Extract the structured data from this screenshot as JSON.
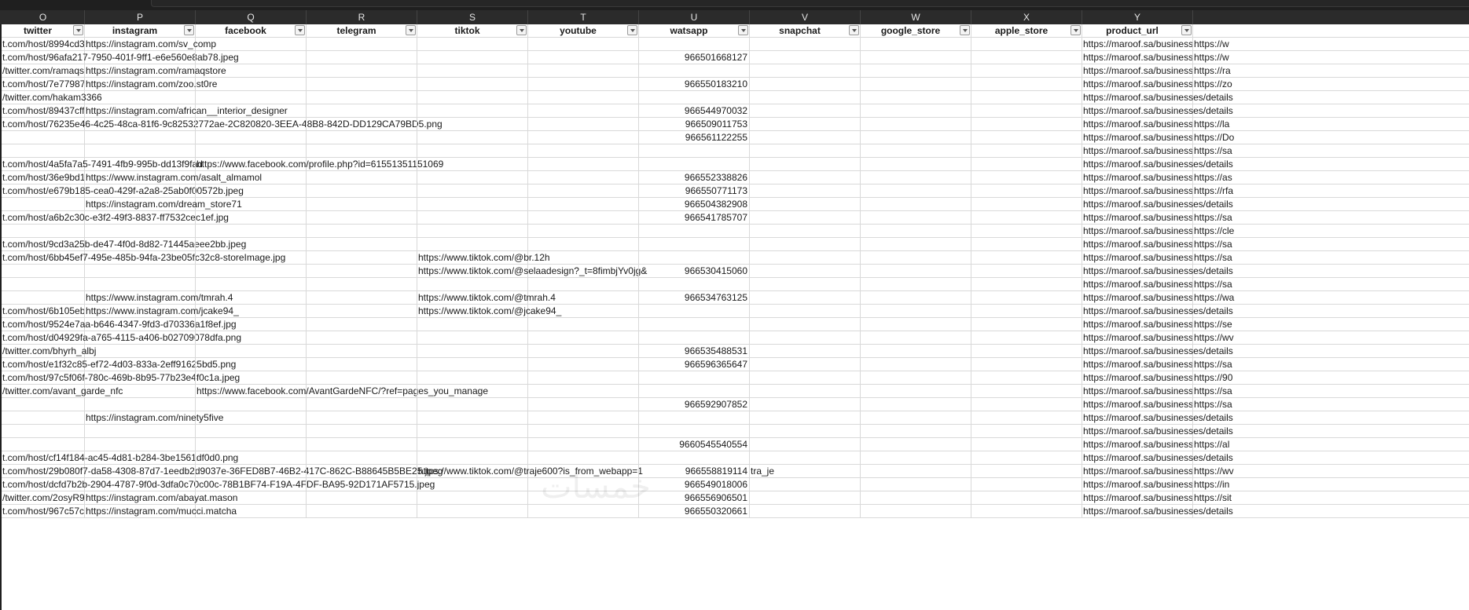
{
  "column_letters": [
    "O",
    "P",
    "Q",
    "R",
    "S",
    "T",
    "U",
    "V",
    "W",
    "X",
    "Y"
  ],
  "headers": [
    "twitter",
    "instagram",
    "facebook",
    "telegram",
    "tiktok",
    "youtube",
    "watsapp",
    "snapchat",
    "google_store",
    "apple_store",
    "product_url"
  ],
  "rows": [
    {
      "O": "t.com/host/8994cd3",
      "P": "https://instagram.com/sv_comp",
      "Q": "",
      "S": "",
      "U": "",
      "V": "",
      "Y": "https://maroof.sa/business",
      "Z": "https://w"
    },
    {
      "O": "t.com/host/96afa217-7950-401f-9ff1-e6e560e8ab78.jpeg",
      "P": "",
      "Q": "",
      "S": "",
      "U": "966501668127",
      "V": "",
      "Y": "https://maroof.sa/business",
      "Z": "https://w"
    },
    {
      "O": "/twitter.com/ramaqs",
      "P": "https://instagram.com/ramaqstore",
      "Q": "",
      "S": "",
      "U": "",
      "V": "",
      "Y": "https://maroof.sa/business",
      "Z": "https://ra"
    },
    {
      "O": "t.com/host/7e77987",
      "P": "https://instagram.com/zoo.st0re",
      "Q": "",
      "S": "",
      "U": "966550183210",
      "V": "",
      "Y": "https://maroof.sa/business",
      "Z": "https://zo"
    },
    {
      "O": "/twitter.com/hakam3366",
      "P": "",
      "Q": "",
      "S": "",
      "U": "",
      "V": "",
      "Y": "https://maroof.sa/businesses/details",
      "Z": ""
    },
    {
      "O": "t.com/host/89437cff",
      "P": "https://instagram.com/african__interior_designer",
      "Q": "",
      "S": "",
      "U": "966544970032",
      "V": "",
      "Y": "https://maroof.sa/businesses/details",
      "Z": ""
    },
    {
      "O": "t.com/host/76235e46-4c25-48ca-81f6-9c82532772ae-2C820820-3EEA-48B8-842D-DD129CA79BD5.png",
      "P": "",
      "Q": "",
      "S": "",
      "U": "966509011753",
      "V": "",
      "Y": "https://maroof.sa/business",
      "Z": "https://la"
    },
    {
      "O": "",
      "P": "",
      "Q": "",
      "S": "",
      "U": "966561122255",
      "V": "",
      "Y": "https://maroof.sa/business",
      "Z": "https://Do"
    },
    {
      "O": "",
      "P": "",
      "Q": "",
      "S": "",
      "U": "",
      "V": "",
      "Y": "https://maroof.sa/business",
      "Z": "https://sa"
    },
    {
      "O": "t.com/host/4a5fa7a5-7491-4fb9-995b-dd13f9fad",
      "P": "",
      "Q": "https://www.facebook.com/profile.php?id=61551351151069",
      "S": "",
      "U": "",
      "V": "",
      "Y": "https://maroof.sa/businesses/details",
      "Z": ""
    },
    {
      "O": "t.com/host/36e9bd1",
      "P": "https://www.instagram.com/asalt_almamol",
      "Q": "",
      "S": "",
      "U": "966552338826",
      "V": "",
      "Y": "https://maroof.sa/business",
      "Z": "https://as"
    },
    {
      "O": "t.com/host/e679b185-cea0-429f-a2a8-25ab0f00572b.jpeg",
      "P": "",
      "Q": "",
      "S": "",
      "U": "966550771173",
      "V": "",
      "Y": "https://maroof.sa/business",
      "Z": "https://rfa"
    },
    {
      "O": "",
      "P": "https://instagram.com/dream_store71",
      "Q": "",
      "S": "",
      "U": "966504382908",
      "V": "",
      "Y": "https://maroof.sa/businesses/details",
      "Z": ""
    },
    {
      "O": "t.com/host/a6b2c30c-e3f2-49f3-8837-ff7532cec1ef.jpg",
      "P": "",
      "Q": "",
      "S": "",
      "U": "966541785707",
      "V": "",
      "Y": "https://maroof.sa/business",
      "Z": "https://sa"
    },
    {
      "O": "",
      "P": "",
      "Q": "",
      "S": "",
      "U": "",
      "V": "",
      "Y": "https://maroof.sa/business",
      "Z": "https://cle"
    },
    {
      "O": "t.com/host/9cd3a25b-de47-4f0d-8d82-71445aeee2bb.jpeg",
      "P": "",
      "Q": "",
      "S": "",
      "U": "",
      "V": "",
      "Y": "https://maroof.sa/business",
      "Z": "https://sa"
    },
    {
      "O": "t.com/host/6bb45ef7-495e-485b-94fa-23be05fc32c8-storeImage.jpg",
      "P": "",
      "Q": "",
      "S": "https://www.tiktok.com/@br.12h",
      "U": "",
      "V": "",
      "Y": "https://maroof.sa/business",
      "Z": "https://sa"
    },
    {
      "O": "",
      "P": "",
      "Q": "",
      "S": "https://www.tiktok.com/@selaadesign?_t=8fimbjYv0jg&",
      "U": "966530415060",
      "V": "",
      "Y": "https://maroof.sa/businesses/details",
      "Z": ""
    },
    {
      "O": "",
      "P": "",
      "Q": "",
      "S": "",
      "U": "",
      "V": "",
      "Y": "https://maroof.sa/business",
      "Z": "https://sa"
    },
    {
      "O": "",
      "P": "https://www.instagram.com/tmrah.4",
      "Q": "",
      "S": "https://www.tiktok.com/@tmrah.4",
      "U": "966534763125",
      "V": "",
      "Y": "https://maroof.sa/business",
      "Z": "https://wa"
    },
    {
      "O": "t.com/host/6b105eb",
      "P": "https://www.instagram.com/jcake94_",
      "Q": "",
      "S": "https://www.tiktok.com/@jcake94_",
      "U": "",
      "V": "",
      "Y": "https://maroof.sa/businesses/details",
      "Z": ""
    },
    {
      "O": "t.com/host/9524e7aa-b646-4347-9fd3-d70336a1f8ef.jpg",
      "P": "",
      "Q": "",
      "S": "",
      "U": "",
      "V": "",
      "Y": "https://maroof.sa/business",
      "Z": "https://se"
    },
    {
      "O": "t.com/host/d04929fa-a765-4115-a406-b02709078dfa.png",
      "P": "",
      "Q": "",
      "S": "",
      "U": "",
      "V": "",
      "Y": "https://maroof.sa/business",
      "Z": "https://wv"
    },
    {
      "O": "/twitter.com/bhyrh_albj",
      "P": "",
      "Q": "",
      "S": "",
      "U": "966535488531",
      "V": "",
      "Y": "https://maroof.sa/businesses/details",
      "Z": ""
    },
    {
      "O": "t.com/host/e1f32c85-ef72-4d03-833a-2eff91625bd5.png",
      "P": "",
      "Q": "",
      "S": "",
      "U": "966596365647",
      "V": "",
      "Y": "https://maroof.sa/business",
      "Z": "https://sa"
    },
    {
      "O": "t.com/host/97c5f06f-780c-469b-8b95-77b23e4f0c1a.jpeg",
      "P": "",
      "Q": "",
      "S": "",
      "U": "",
      "V": "",
      "Y": "https://maroof.sa/business",
      "Z": "https://90"
    },
    {
      "O": "/twitter.com/avant_garde_nfc",
      "P": "",
      "Q": "https://www.facebook.com/AvantGardeNFC/?ref=pages_you_manage",
      "S": "",
      "U": "",
      "V": "",
      "Y": "https://maroof.sa/business",
      "Z": "https://sa"
    },
    {
      "O": "",
      "P": "",
      "Q": "",
      "S": "",
      "U": "966592907852",
      "V": "",
      "Y": "https://maroof.sa/business",
      "Z": "https://sa"
    },
    {
      "O": "",
      "P": "https://instagram.com/ninety5five",
      "Q": "",
      "S": "",
      "U": "",
      "V": "",
      "Y": "https://maroof.sa/businesses/details",
      "Z": ""
    },
    {
      "O": "",
      "P": "",
      "Q": "",
      "S": "",
      "U": "",
      "V": "",
      "Y": "https://maroof.sa/businesses/details",
      "Z": ""
    },
    {
      "O": "",
      "P": "",
      "Q": "",
      "S": "",
      "U": "9660545540554",
      "V": "",
      "Y": "https://maroof.sa/business",
      "Z": "https://al"
    },
    {
      "O": "t.com/host/cf14f184-ac45-4d81-b284-3be1561df0d0.png",
      "P": "",
      "Q": "",
      "S": "",
      "U": "",
      "V": "",
      "Y": "https://maroof.sa/businesses/details",
      "Z": ""
    },
    {
      "O": "t.com/host/29b080f7-da58-4308-87d7-1eedb2d9037e-36FED8B7-46B2-417C-862C-B88645B5BE25.jpeg",
      "P": "",
      "Q": "",
      "S": "https://www.tiktok.com/@traje600?is_from_webapp=1",
      "U": "966558819114",
      "V": "tra_je",
      "Y": "https://maroof.sa/business",
      "Z": "https://wv"
    },
    {
      "O": "t.com/host/dcfd7b2b-2904-4787-9f0d-3dfa0c70c00c-78B1BF74-F19A-4FDF-BA95-92D171AF5715.jpeg",
      "P": "",
      "Q": "",
      "S": "",
      "U": "966549018006",
      "V": "",
      "Y": "https://maroof.sa/business",
      "Z": "https://in"
    },
    {
      "O": "/twitter.com/2osyR9",
      "P": "https://instagram.com/abayat.mason",
      "Q": "",
      "S": "",
      "U": "966556906501",
      "V": "",
      "Y": "https://maroof.sa/business",
      "Z": "https://sit"
    },
    {
      "O": "t.com/host/967c57c",
      "P": "https://instagram.com/mucci.matcha",
      "Q": "",
      "S": "",
      "U": "966550320661",
      "V": "",
      "Y": "https://maroof.sa/businesses/details",
      "Z": ""
    }
  ],
  "watermark": "خمسات"
}
